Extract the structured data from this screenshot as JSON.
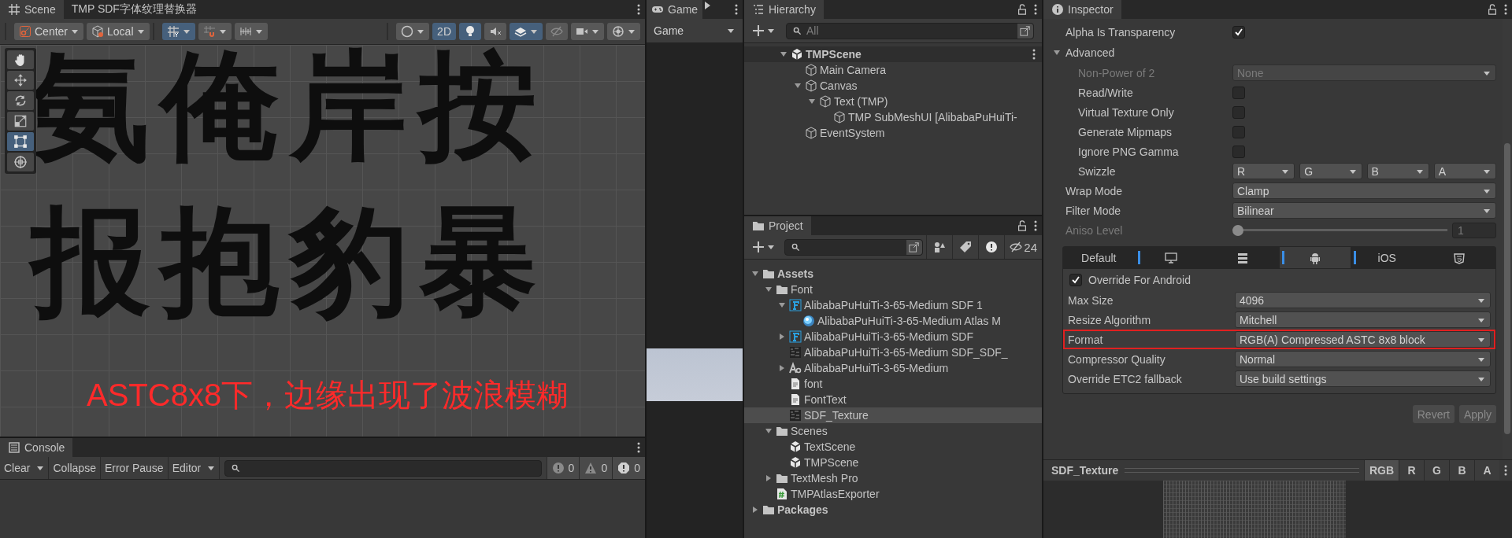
{
  "scene_panel": {
    "tabs": [
      {
        "label": "Scene",
        "kind": "scene",
        "selected": true
      },
      {
        "label": "TMP SDF字体纹理替换器",
        "kind": "plain",
        "selected": false
      }
    ],
    "toolbar": [
      [
        {
          "kind": "pivot",
          "label": "Center",
          "selected": false,
          "dropdown": true
        },
        {
          "kind": "local",
          "label": "Local",
          "selected": false,
          "dropdown": true
        }
      ],
      [
        {
          "kind": "grid",
          "selected": true,
          "dropdown": true
        },
        {
          "kind": "snap",
          "selected": false,
          "dropdown": true
        },
        {
          "kind": "increment",
          "selected": false,
          "dropdown": true
        }
      ],
      [
        {
          "kind": "shading",
          "selected": false,
          "dropdown": true
        },
        {
          "kind": "text",
          "label": "2D",
          "selected": true,
          "dropdown": false
        },
        {
          "kind": "light",
          "selected": true,
          "dropdown": false
        },
        {
          "kind": "audio",
          "selected": false,
          "dropdown": false
        },
        {
          "kind": "effects",
          "selected": true,
          "dropdown": true
        },
        {
          "kind": "hidden",
          "selected": false,
          "dropdown": false
        },
        {
          "kind": "camera",
          "selected": false,
          "dropdown": true
        },
        {
          "kind": "gizmos",
          "selected": false,
          "dropdown": true
        }
      ]
    ],
    "tools": [
      {
        "kind": "hand",
        "selected": false
      },
      {
        "kind": "move",
        "selected": false
      },
      {
        "kind": "rotate",
        "selected": false
      },
      {
        "kind": "scale",
        "selected": false
      },
      {
        "kind": "rect",
        "selected": true
      },
      {
        "kind": "transform",
        "selected": false
      }
    ],
    "scene_text_rows": [
      "氨俺岸按",
      "报抱豹暴"
    ],
    "annotation": "ASTC8x8下，边缘出现了波浪模糊"
  },
  "console": {
    "tab": "Console",
    "buttons": [
      {
        "label": "Clear",
        "dropdown": true
      },
      {
        "label": "Collapse",
        "dropdown": false
      },
      {
        "label": "Error Pause",
        "dropdown": false
      },
      {
        "label": "Editor",
        "dropdown": true
      }
    ],
    "counters": [
      {
        "kind": "info",
        "count": "0"
      },
      {
        "kind": "warning",
        "count": "0"
      },
      {
        "kind": "error",
        "count": "0"
      }
    ]
  },
  "game": {
    "tab": "Game",
    "display": "Game"
  },
  "hierarchy": {
    "tab": "Hierarchy",
    "search": {
      "placeholder": "All"
    },
    "items": [
      {
        "label": "TMPScene",
        "kind": "scene",
        "expanded": true,
        "selected": false,
        "children": [
          {
            "label": "Main Camera",
            "kind": "object",
            "selected": false
          },
          {
            "label": "Canvas",
            "kind": "object",
            "expanded": true,
            "selected": false,
            "children": [
              {
                "label": "Text (TMP)",
                "kind": "object",
                "expanded": true,
                "selected": false,
                "children": [
                  {
                    "label": "TMP SubMeshUI [AlibabaPuHuiTi-",
                    "kind": "object",
                    "selected": false
                  }
                ]
              }
            ]
          },
          {
            "label": "EventSystem",
            "kind": "object",
            "selected": false
          }
        ]
      }
    ]
  },
  "project": {
    "tab": "Project",
    "hidden_count": "24",
    "items": [
      {
        "label": "Assets",
        "kind": "folder",
        "expanded": true,
        "selected": false,
        "children": [
          {
            "label": "Font",
            "kind": "folder",
            "expanded": true,
            "selected": false,
            "children": [
              {
                "label": "AlibabaPuHuiTi-3-65-Medium SDF 1",
                "kind": "font-asset",
                "expanded": true,
                "selected": false,
                "children": [
                  {
                    "label": "AlibabaPuHuiTi-3-65-Medium Atlas M",
                    "kind": "material",
                    "selected": false
                  }
                ]
              },
              {
                "label": "AlibabaPuHuiTi-3-65-Medium SDF",
                "kind": "font-asset",
                "expanded": false,
                "selected": false
              },
              {
                "label": "AlibabaPuHuiTi-3-65-Medium SDF_SDF_",
                "kind": "texture",
                "selected": false
              },
              {
                "label": "AlibabaPuHuiTi-3-65-Medium",
                "kind": "font",
                "expanded": false,
                "selected": false
              },
              {
                "label": "font",
                "kind": "text",
                "selected": false
              },
              {
                "label": "FontText",
                "kind": "text",
                "selected": false
              },
              {
                "label": "SDF_Texture",
                "kind": "texture",
                "selected": true
              }
            ]
          },
          {
            "label": "Scenes",
            "kind": "folder",
            "expanded": true,
            "selected": false,
            "children": [
              {
                "label": "TextScene",
                "kind": "scene",
                "selected": false
              },
              {
                "label": "TMPScene",
                "kind": "scene",
                "selected": false
              }
            ]
          },
          {
            "label": "TextMesh Pro",
            "kind": "folder",
            "expanded": false,
            "selected": false
          },
          {
            "label": "TMPAtlasExporter",
            "kind": "script",
            "selected": false
          }
        ]
      },
      {
        "label": "Packages",
        "kind": "folder",
        "expanded": false,
        "selected": false
      }
    ]
  },
  "inspector": {
    "tab": "Inspector",
    "rows": [
      {
        "kind": "checkbox",
        "label": "Alpha Is Transparency",
        "checked": true,
        "disabled": false
      },
      {
        "kind": "section",
        "label": "Advanced",
        "expanded": true,
        "children": [
          {
            "kind": "dropdown",
            "label": "Non-Power of 2",
            "value": "None",
            "disabled": true
          },
          {
            "kind": "checkbox",
            "label": "Read/Write",
            "checked": false,
            "disabled": false
          },
          {
            "kind": "checkbox",
            "label": "Virtual Texture Only",
            "checked": false,
            "disabled": false
          },
          {
            "kind": "checkbox",
            "label": "Generate Mipmaps",
            "checked": false,
            "disabled": false
          },
          {
            "kind": "checkbox",
            "label": "Ignore PNG Gamma",
            "checked": false,
            "disabled": false
          },
          {
            "kind": "swizzle",
            "label": "Swizzle",
            "values": [
              "R",
              "G",
              "B",
              "A"
            ],
            "disabled": false
          }
        ]
      },
      {
        "kind": "dropdown",
        "label": "Wrap Mode",
        "value": "Clamp",
        "disabled": false
      },
      {
        "kind": "dropdown",
        "label": "Filter Mode",
        "value": "Bilinear",
        "disabled": false
      },
      {
        "kind": "slider",
        "label": "Aniso Level",
        "value": "1",
        "level": 0,
        "disabled": true
      }
    ],
    "platform_tabs": [
      {
        "kind": "text",
        "label": "Default",
        "selected": false,
        "overridden": false
      },
      {
        "kind": "desktop",
        "selected": false,
        "overridden": true
      },
      {
        "kind": "server",
        "selected": false,
        "overridden": false
      },
      {
        "kind": "android",
        "selected": true,
        "overridden": true
      },
      {
        "kind": "text",
        "label": "iOS",
        "selected": false,
        "overridden": true
      },
      {
        "kind": "html5",
        "selected": false,
        "overridden": false
      }
    ],
    "platform": {
      "override": {
        "label": "Override For Android",
        "checked": true
      },
      "rows": [
        {
          "label": "Max Size",
          "value": "4096",
          "highlighted": false
        },
        {
          "label": "Resize Algorithm",
          "value": "Mitchell",
          "highlighted": false
        },
        {
          "label": "Format",
          "value": "RGB(A) Compressed ASTC 8x8 block",
          "highlighted": true
        },
        {
          "label": "Compressor Quality",
          "value": "Normal",
          "highlighted": false
        },
        {
          "label": "Override ETC2 fallback",
          "value": "Use build settings",
          "highlighted": false
        }
      ]
    },
    "buttons": [
      {
        "label": "Revert",
        "disabled": true
      },
      {
        "label": "Apply",
        "disabled": true
      }
    ]
  },
  "preview": {
    "title": "SDF_Texture",
    "channels": [
      {
        "label": "RGB",
        "selected": true
      },
      {
        "label": "R",
        "selected": false
      },
      {
        "label": "G",
        "selected": false
      },
      {
        "label": "B",
        "selected": false
      },
      {
        "label": "A",
        "selected": false
      }
    ]
  }
}
